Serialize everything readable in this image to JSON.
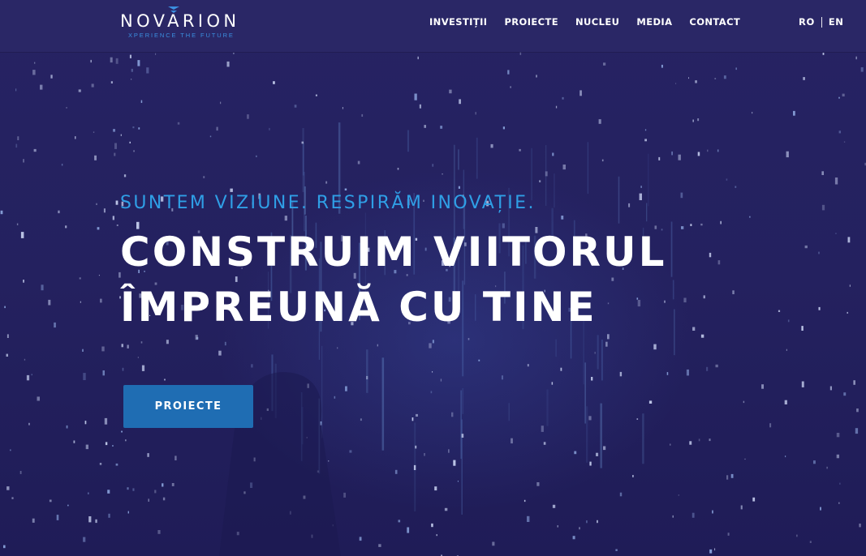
{
  "brand": {
    "name": "NOVARION",
    "tagline": "XPERIENCE THE FUTURE"
  },
  "nav": {
    "items": [
      {
        "label": "INVESTIȚII"
      },
      {
        "label": "PROIECTE"
      },
      {
        "label": "NUCLEU"
      },
      {
        "label": "MEDIA"
      },
      {
        "label": "CONTACT"
      }
    ]
  },
  "language": {
    "options": [
      "RO",
      "EN"
    ],
    "selected": "RO"
  },
  "hero": {
    "kicker": "SUNTEM VIZIUNE. RESPIRĂM INOVAȚIE.",
    "title_line1": "CONSTRUIM VIITORUL",
    "title_line2": "ÎMPREUNĂ CU TINE",
    "cta_label": "PROIECTE"
  },
  "colors": {
    "header_bg": "#2a2766",
    "page_bg": "#24215f",
    "accent_blue": "#2f9fe6",
    "button_bg": "#1f6db3",
    "text": "#ffffff"
  }
}
